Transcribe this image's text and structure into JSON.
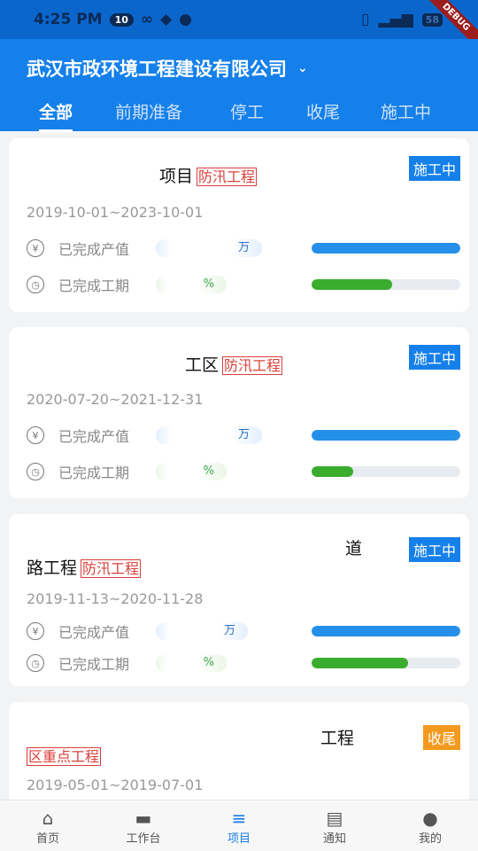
{
  "status_bar": {
    "time": "4:25 PM",
    "notif_count": "10",
    "battery": "58",
    "debug": "DEBUG"
  },
  "header": {
    "company": "武汉市政环境工程建设有限公司"
  },
  "tabs": [
    {
      "label": "全部",
      "active": true
    },
    {
      "label": "前期准备"
    },
    {
      "label": "停工"
    },
    {
      "label": "收尾"
    },
    {
      "label": "施工中"
    }
  ],
  "labels": {
    "output": "已完成产值",
    "period": "已完成工期",
    "wan": "万",
    "pct": "%"
  },
  "projects": [
    {
      "title_a": "项目",
      "title_b": "",
      "tag": "防汛工程",
      "status": "施工中",
      "status_color": "#1580ea",
      "dates": "2019-10-01~2023-10-01",
      "output_progress": 100,
      "period_progress": 54
    },
    {
      "title_a": "工区",
      "title_b": "",
      "tag": "防汛工程",
      "status": "施工中",
      "status_color": "#1580ea",
      "dates": "2020-07-20~2021-12-31",
      "output_progress": 100,
      "period_progress": 28
    },
    {
      "title_a": "道",
      "title_b": "路工程",
      "tag": "防汛工程",
      "status": "施工中",
      "status_color": "#1580ea",
      "dates": "2019-11-13~2020-11-28",
      "output_progress": 100,
      "period_progress": 65
    },
    {
      "title_a": "工程",
      "title_b": "",
      "tag": "区重点工程",
      "status": "收尾",
      "status_color": "#f39a1e",
      "dates": "2019-05-01~2019-07-01"
    }
  ],
  "bottom_nav": [
    {
      "label": "首页",
      "icon": "home-icon"
    },
    {
      "label": "工作台",
      "icon": "briefcase-icon"
    },
    {
      "label": "项目",
      "icon": "list-icon",
      "active": true
    },
    {
      "label": "通知",
      "icon": "message-icon"
    },
    {
      "label": "我的",
      "icon": "person-icon"
    }
  ]
}
